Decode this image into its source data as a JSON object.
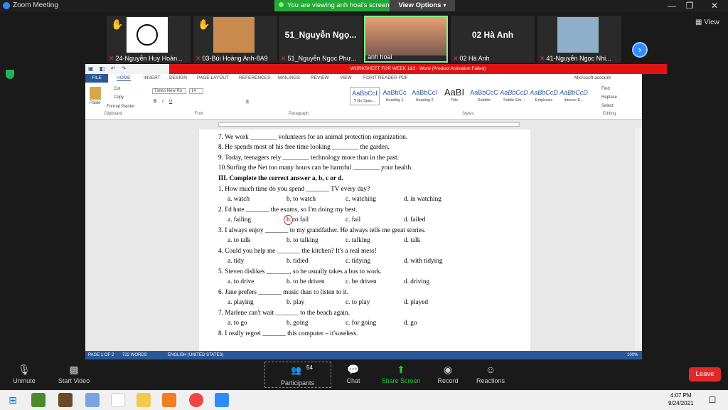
{
  "app": {
    "title": "Zoom Meeting"
  },
  "banner": {
    "text": "You are viewing anh hoai's screen",
    "options": "View Options"
  },
  "view": "View",
  "participants_strip": [
    {
      "name": "24-Nguyễn Huy Hoàn...",
      "hand": true
    },
    {
      "name": "03-Bùi Hoàng Anh-8A9",
      "hand": true
    },
    {
      "name": "51_Nguyễn Ngọc Phư...",
      "big": "51_Nguyễn Ngọ..."
    },
    {
      "name": "anh hoai"
    },
    {
      "name": "02 Hà Anh",
      "big": "02 Hà Anh"
    },
    {
      "name": "41-Nguyễn Ngọc Nhi..."
    }
  ],
  "word": {
    "title": "WORKSHEET FOR WEEK 1&2 - Word (Product Activation Failed)",
    "tabs": [
      "FILE",
      "HOME",
      "INSERT",
      "DESIGN",
      "PAGE LAYOUT",
      "REFERENCES",
      "MAILINGS",
      "REVIEW",
      "VIEW",
      "FOXIT READER PDF"
    ],
    "account": "Microsoft account",
    "font": "Times New Ro",
    "size": "14",
    "clipboard": {
      "cut": "Cut",
      "copy": "Copy",
      "paste": "Paste",
      "painter": "Format Painter",
      "label": "Clipboard"
    },
    "groups": {
      "font": "Font",
      "paragraph": "Paragraph",
      "styles": "Styles",
      "editing": "Editing"
    },
    "styles": [
      {
        "s": "AaBbCcI",
        "l": "¶ No Spac..."
      },
      {
        "s": "AaBbCc",
        "l": "Heading 1"
      },
      {
        "s": "AaBbCcI",
        "l": "Heading 2"
      },
      {
        "s": "AaBI",
        "l": "Title"
      },
      {
        "s": "AaBbCcC",
        "l": "Subtitle"
      },
      {
        "s": "AaBbCcD",
        "l": "Subtle Em..."
      },
      {
        "s": "AaBbCcD",
        "l": "Emphasis"
      },
      {
        "s": "AaBbCcD",
        "l": "Intense E..."
      }
    ],
    "editing": {
      "find": "Find",
      "replace": "Replace",
      "select": "Select"
    },
    "status": {
      "page": "PAGE 1 OF 2",
      "words": "722 WORDS",
      "lang": "ENGLISH (UNITED STATES)",
      "zoom": "100%"
    }
  },
  "doc": {
    "lines": [
      "7.  We work ________ volunteers for an animal protection organization.",
      "8.  He spends most of his free time looking   ________ the garden.",
      "9.  Today, teenagers rely ________ technology more than in the past.",
      "10.Surfing the Net too many hours can be harmful ________ your health."
    ],
    "section": "III. Complete the correct answer a, b, c or d.",
    "questions": [
      {
        "q": "1.  How much time do you spend _______ TV every day?",
        "o": [
          "a. watch",
          "b. to watch",
          "c. watching",
          "d. in watching"
        ]
      },
      {
        "q": "2.  I'd hate _______ the exams, so I'm doing my best.",
        "o": [
          "a. failing",
          "b. to fail",
          "c. fail",
          "d. failed"
        ]
      },
      {
        "q": "3.  I always enjoy _______ to my grandfather. He always tells me great stories.",
        "o": [
          "a. to talk",
          "b. to talking",
          "c. talking",
          "d. talk"
        ]
      },
      {
        "q": "4.  Could you help me _______ the kitchen? It's a real mess!",
        "o": [
          "a. tidy",
          "b. tidied",
          "c. tidying",
          "d. with tidying"
        ]
      },
      {
        "q": "5.  Steven dislikes _______, so he usually takes a bus to work.",
        "o": [
          "a. to drive",
          "b. to be driven",
          "c. be driven",
          "d. driving"
        ]
      },
      {
        "q": "6.  Jane prefers _______ music than to listen to it.",
        "o": [
          "a. playing",
          "b. play",
          "c. to play",
          "d. played"
        ]
      },
      {
        "q": "7.  Marlene can't wait _______ to the beach again.",
        "o": [
          "a. to go",
          "b. going",
          "c. for going",
          "d. go"
        ]
      }
    ],
    "last": "8.  I really regret _______ this computer – it'suseless."
  },
  "controls": {
    "unmute": "Unmute",
    "video": "Start Video",
    "participants": "Participants",
    "count": "54",
    "chat": "Chat",
    "share": "Share Screen",
    "record": "Record",
    "reactions": "Reactions",
    "leave": "Leave"
  },
  "clock": {
    "time": "4:07 PM",
    "date": "9/24/2021"
  },
  "colors": {
    "word_blue": "#2b579a",
    "zoom_blue": "#2d8cff",
    "share_green": "#23a936",
    "leave_red": "#e02828"
  }
}
